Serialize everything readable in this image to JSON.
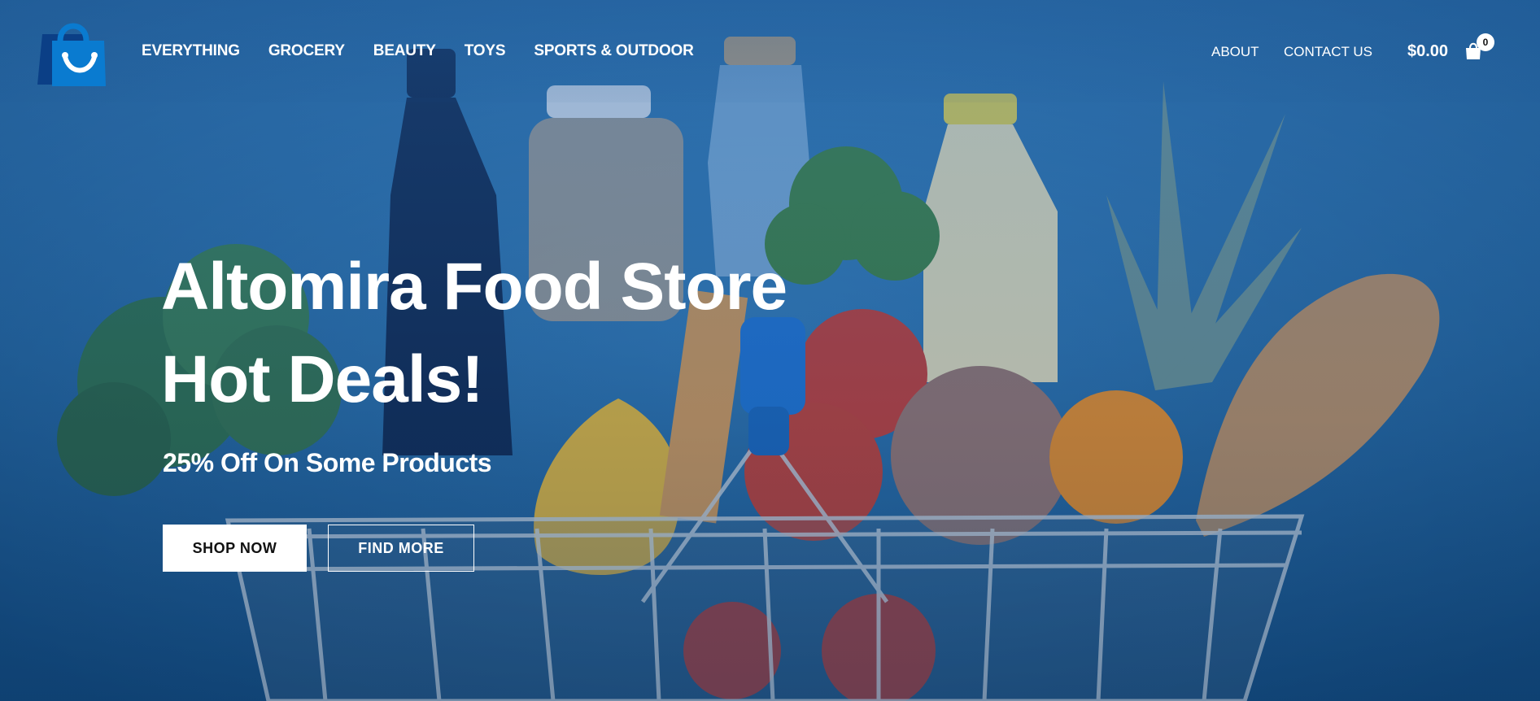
{
  "nav": {
    "items": [
      {
        "label": "EVERYTHING"
      },
      {
        "label": "GROCERY"
      },
      {
        "label": "BEAUTY"
      },
      {
        "label": "TOYS"
      },
      {
        "label": "SPORTS & OUTDOOR"
      }
    ],
    "about": "ABOUT",
    "contact": "CONTACT US"
  },
  "cart": {
    "total": "$0.00",
    "count": "0"
  },
  "hero": {
    "title_line1": "Altomira Food Store",
    "title_line2": "Hot Deals!",
    "subtitle": "25% Off On Some Products",
    "primary_button": "SHOP NOW",
    "secondary_button": "FIND MORE"
  },
  "colors": {
    "brand": "#0a7bd0",
    "background": "#1d5c96"
  },
  "icons": {
    "logo": "shopping-bag-smile-icon",
    "cart": "shopping-bag-icon"
  }
}
